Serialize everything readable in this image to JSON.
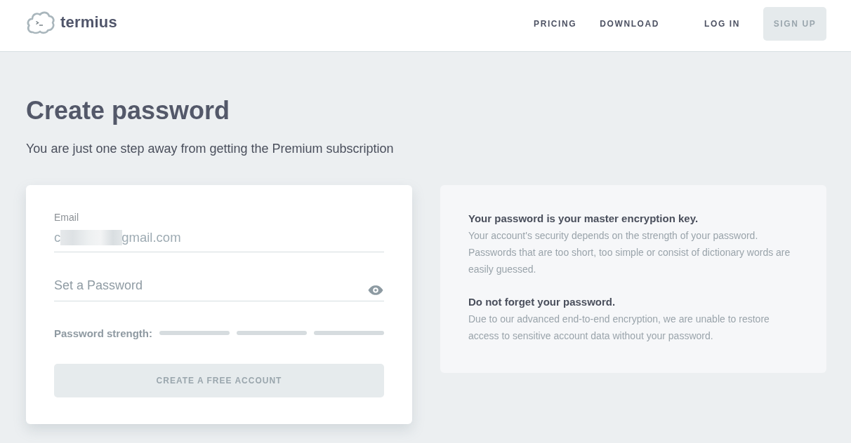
{
  "header": {
    "logo": "termius",
    "nav": [
      {
        "label": "PRICING"
      },
      {
        "label": "DOWNLOAD"
      }
    ],
    "login": "LOG IN",
    "signup": {
      "label": "SIGN UP",
      "disabled": true
    }
  },
  "page": {
    "title": "Create password",
    "subtitle": "You are just one step away from getting the Premium subscription"
  },
  "form": {
    "email": {
      "label": "Email",
      "value_start": "c",
      "redacted": true,
      "value_end": "gmail.com"
    },
    "password": {
      "placeholder": "Set a Password"
    },
    "strength": {
      "label": "Password strength:",
      "segments": [
        {
          "filled": false
        },
        {
          "filled": false
        },
        {
          "filled": false
        }
      ]
    },
    "submit": {
      "label": "CREATE A FREE ACCOUNT",
      "disabled": true
    }
  },
  "info": {
    "sections": [
      {
        "heading": "Your password is your master encryption key.",
        "text": "Your account's security depends on the strength of your password. Passwords that are too short, too simple or consist of dictionary words are easily guessed."
      },
      {
        "heading": "Do not forget your password.",
        "text": "Due to our advanced end-to-end encryption, we are unable to restore access to sensitive account data without your password."
      }
    ]
  }
}
